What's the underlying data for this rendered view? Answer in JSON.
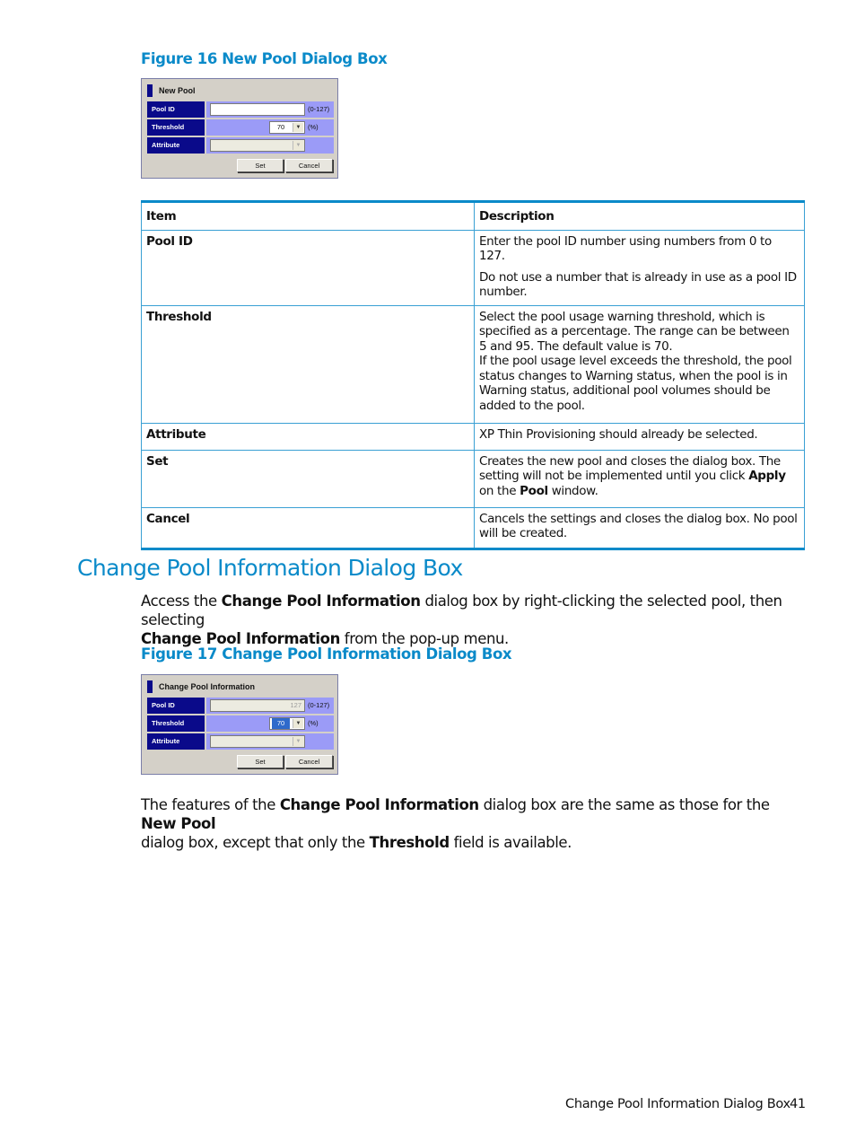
{
  "figure16": {
    "caption": "Figure 16 New Pool Dialog Box",
    "dialog": {
      "title": "New Pool",
      "fields": [
        {
          "label": "Pool ID",
          "value": "",
          "hint": "(0-127)",
          "kind": "text",
          "enabled": true
        },
        {
          "label": "Threshold",
          "value": "70",
          "hint": "(%)",
          "kind": "select",
          "enabled": true
        },
        {
          "label": "Attribute",
          "value": "",
          "hint": "",
          "kind": "select",
          "enabled": false
        }
      ],
      "buttons": {
        "set": "Set",
        "cancel": "Cancel"
      }
    }
  },
  "table": {
    "headers": {
      "item": "Item",
      "description": "Description"
    },
    "rows": [
      {
        "item": "Pool ID",
        "desc": [
          "Enter the pool ID number using numbers from 0 to 127.",
          "Do not use a number that is already in use as a pool ID number."
        ]
      },
      {
        "item": "Threshold",
        "desc": [
          "Select the pool usage warning threshold, which is specified as a percentage. The range can be between 5 and 95. The default value is 70.",
          "If the pool usage level exceeds the threshold, the pool status changes to Warning status, when the pool is in Warning status, additional pool volumes should be added to the pool."
        ]
      },
      {
        "item": "Attribute",
        "desc": [
          "XP Thin Provisioning should already be selected."
        ]
      },
      {
        "item": "Set",
        "desc_parts": [
          "Creates the new pool and closes the dialog box. The setting will not be implemented until you click ",
          "Apply",
          " on the ",
          "Pool",
          " window."
        ]
      },
      {
        "item": "Cancel",
        "desc": [
          "Cancels the settings and closes the dialog box. No pool will be created."
        ]
      }
    ]
  },
  "section": {
    "title": "Change Pool Information Dialog Box",
    "intro_parts": [
      "Access the ",
      "Change Pool Information",
      " dialog box by right-clicking the selected pool, then selecting ",
      "Change Pool Information",
      " from the pop-up menu."
    ]
  },
  "figure17": {
    "caption": "Figure 17 Change Pool Information Dialog Box",
    "dialog": {
      "title": "Change Pool Information",
      "fields": [
        {
          "label": "Pool ID",
          "value": "127",
          "hint": "(0-127)",
          "kind": "text",
          "enabled": false
        },
        {
          "label": "Threshold",
          "value": "70",
          "hint": "(%)",
          "kind": "select",
          "enabled": true,
          "selected": true
        },
        {
          "label": "Attribute",
          "value": "",
          "hint": "",
          "kind": "select",
          "enabled": false
        }
      ],
      "buttons": {
        "set": "Set",
        "cancel": "Cancel"
      }
    }
  },
  "closing_parts": [
    "The features of the ",
    "Change Pool Information",
    " dialog box are the same as those for the ",
    "New Pool",
    " dialog box, except that only the ",
    "Threshold",
    " field is available."
  ],
  "footer": {
    "title": "Change Pool Information Dialog Box",
    "page": "41"
  }
}
